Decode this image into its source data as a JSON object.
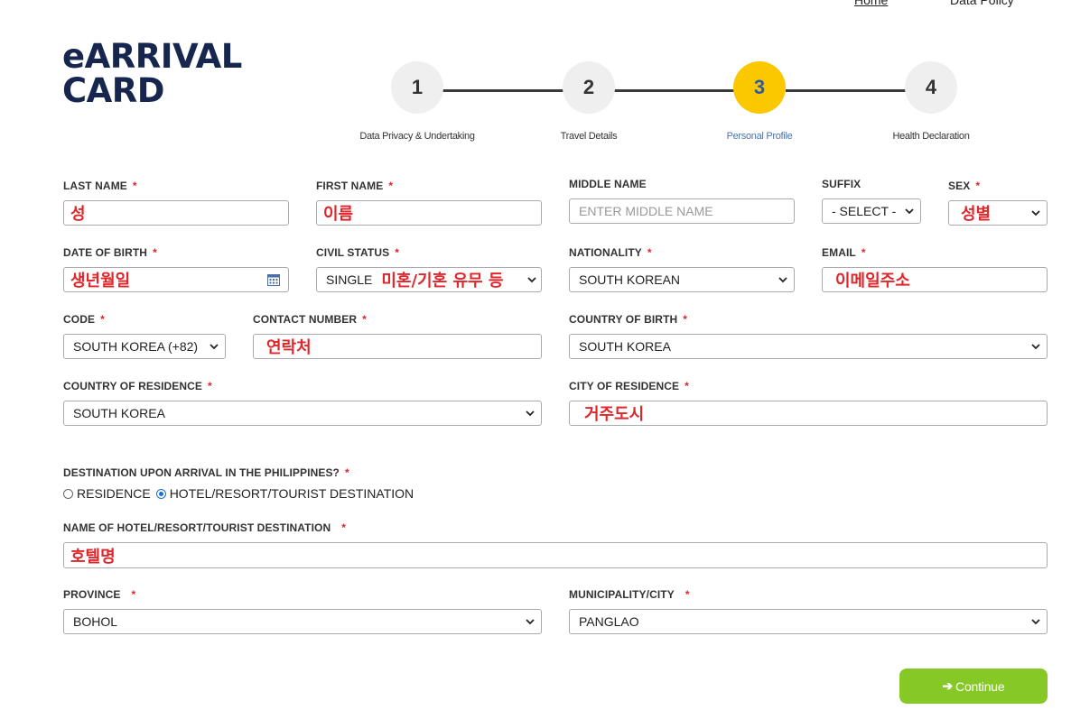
{
  "nav": {
    "home": "Home",
    "data_policy": "Data Policy"
  },
  "logo": {
    "line1": "eARRIVAL",
    "line2": "CARD"
  },
  "steps": [
    {
      "number": "1",
      "label": "Data Privacy & Undertaking",
      "active": false
    },
    {
      "number": "2",
      "label": "Travel Details",
      "active": false
    },
    {
      "number": "3",
      "label": "Personal Profile",
      "active": true
    },
    {
      "number": "4",
      "label": "Health Declaration",
      "active": false
    }
  ],
  "required_mark": "*",
  "form": {
    "last_name": {
      "label": "LAST NAME",
      "value": "성"
    },
    "first_name": {
      "label": "FIRST NAME",
      "value": "이름"
    },
    "middle_name": {
      "label": "MIDDLE NAME",
      "placeholder": "ENTER MIDDLE NAME"
    },
    "suffix": {
      "label": "SUFFIX",
      "value": "- SELECT -"
    },
    "sex": {
      "label": "SEX",
      "value": "성별"
    },
    "date_of_birth": {
      "label": "DATE OF BIRTH",
      "value": "생년월일"
    },
    "civil_status": {
      "label": "CIVIL STATUS",
      "value": "SINGLE",
      "note": "미혼/기혼 유무 등"
    },
    "nationality": {
      "label": "NATIONALITY",
      "value": "SOUTH KOREAN"
    },
    "email": {
      "label": "EMAIL",
      "value": "이메일주소"
    },
    "code": {
      "label": "CODE",
      "value": "SOUTH KOREA (+82)"
    },
    "contact_number": {
      "label": "CONTACT NUMBER",
      "value": "연락처"
    },
    "country_of_birth": {
      "label": "COUNTRY OF BIRTH",
      "value": "SOUTH KOREA"
    },
    "country_of_residence": {
      "label": "COUNTRY OF RESIDENCE",
      "value": "SOUTH KOREA"
    },
    "city_of_residence": {
      "label": "CITY OF RESIDENCE",
      "value": "거주도시"
    },
    "destination": {
      "label": "DESTINATION UPON ARRIVAL IN THE PHILIPPINES?",
      "options": [
        "RESIDENCE",
        "HOTEL/RESORT/TOURIST DESTINATION"
      ],
      "selected": "HOTEL/RESORT/TOURIST DESTINATION"
    },
    "hotel_name": {
      "label": "NAME OF HOTEL/RESORT/TOURIST DESTINATION",
      "value": "호텔명"
    },
    "province": {
      "label": "PROVINCE",
      "value": "BOHOL"
    },
    "municipality": {
      "label": "MUNICIPALITY/CITY",
      "value": "PANGLAO"
    }
  },
  "continue_button": {
    "label": "Continue"
  },
  "colors": {
    "logo": "#16264f",
    "active_step": "#fbc800",
    "active_step_number": "#2b5aa8",
    "required": "#e0262b",
    "annotation": "#e0262b",
    "continue": "#86c926"
  }
}
